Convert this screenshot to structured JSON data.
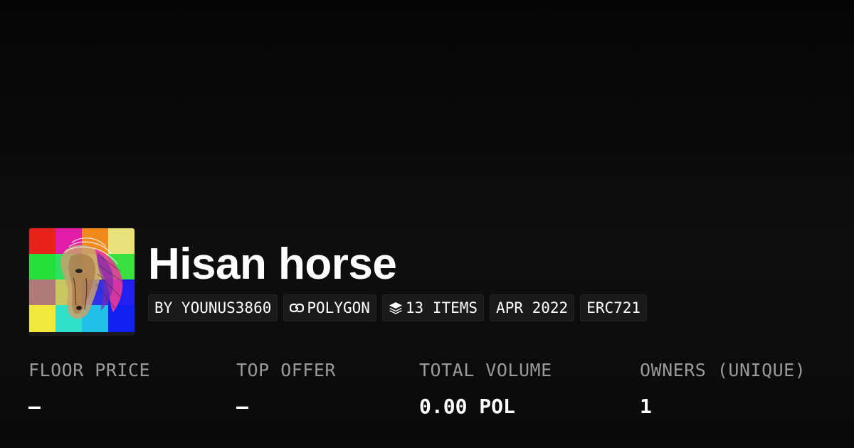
{
  "collection": {
    "name": "Hisan horse",
    "avatar_icon": "horse-artwork-image"
  },
  "tags": [
    {
      "label": "BY YOUNUS3860",
      "icon": null
    },
    {
      "label": "POLYGON",
      "icon": "chain-link-icon"
    },
    {
      "label": "13 ITEMS",
      "icon": "layers-icon"
    },
    {
      "label": "APR 2022",
      "icon": null
    },
    {
      "label": "ERC721",
      "icon": null
    }
  ],
  "stats": [
    {
      "label": "FLOOR PRICE",
      "value": "–"
    },
    {
      "label": "TOP OFFER",
      "value": "–"
    },
    {
      "label": "TOTAL VOLUME",
      "value": "0.00 POL"
    },
    {
      "label": "OWNERS (UNIQUE)",
      "value": "1"
    }
  ],
  "colors": {
    "background": "#0c0c0c",
    "tag_background": "#1a1a1a",
    "label_text": "#9a9a9a",
    "value_text": "#ffffff"
  }
}
